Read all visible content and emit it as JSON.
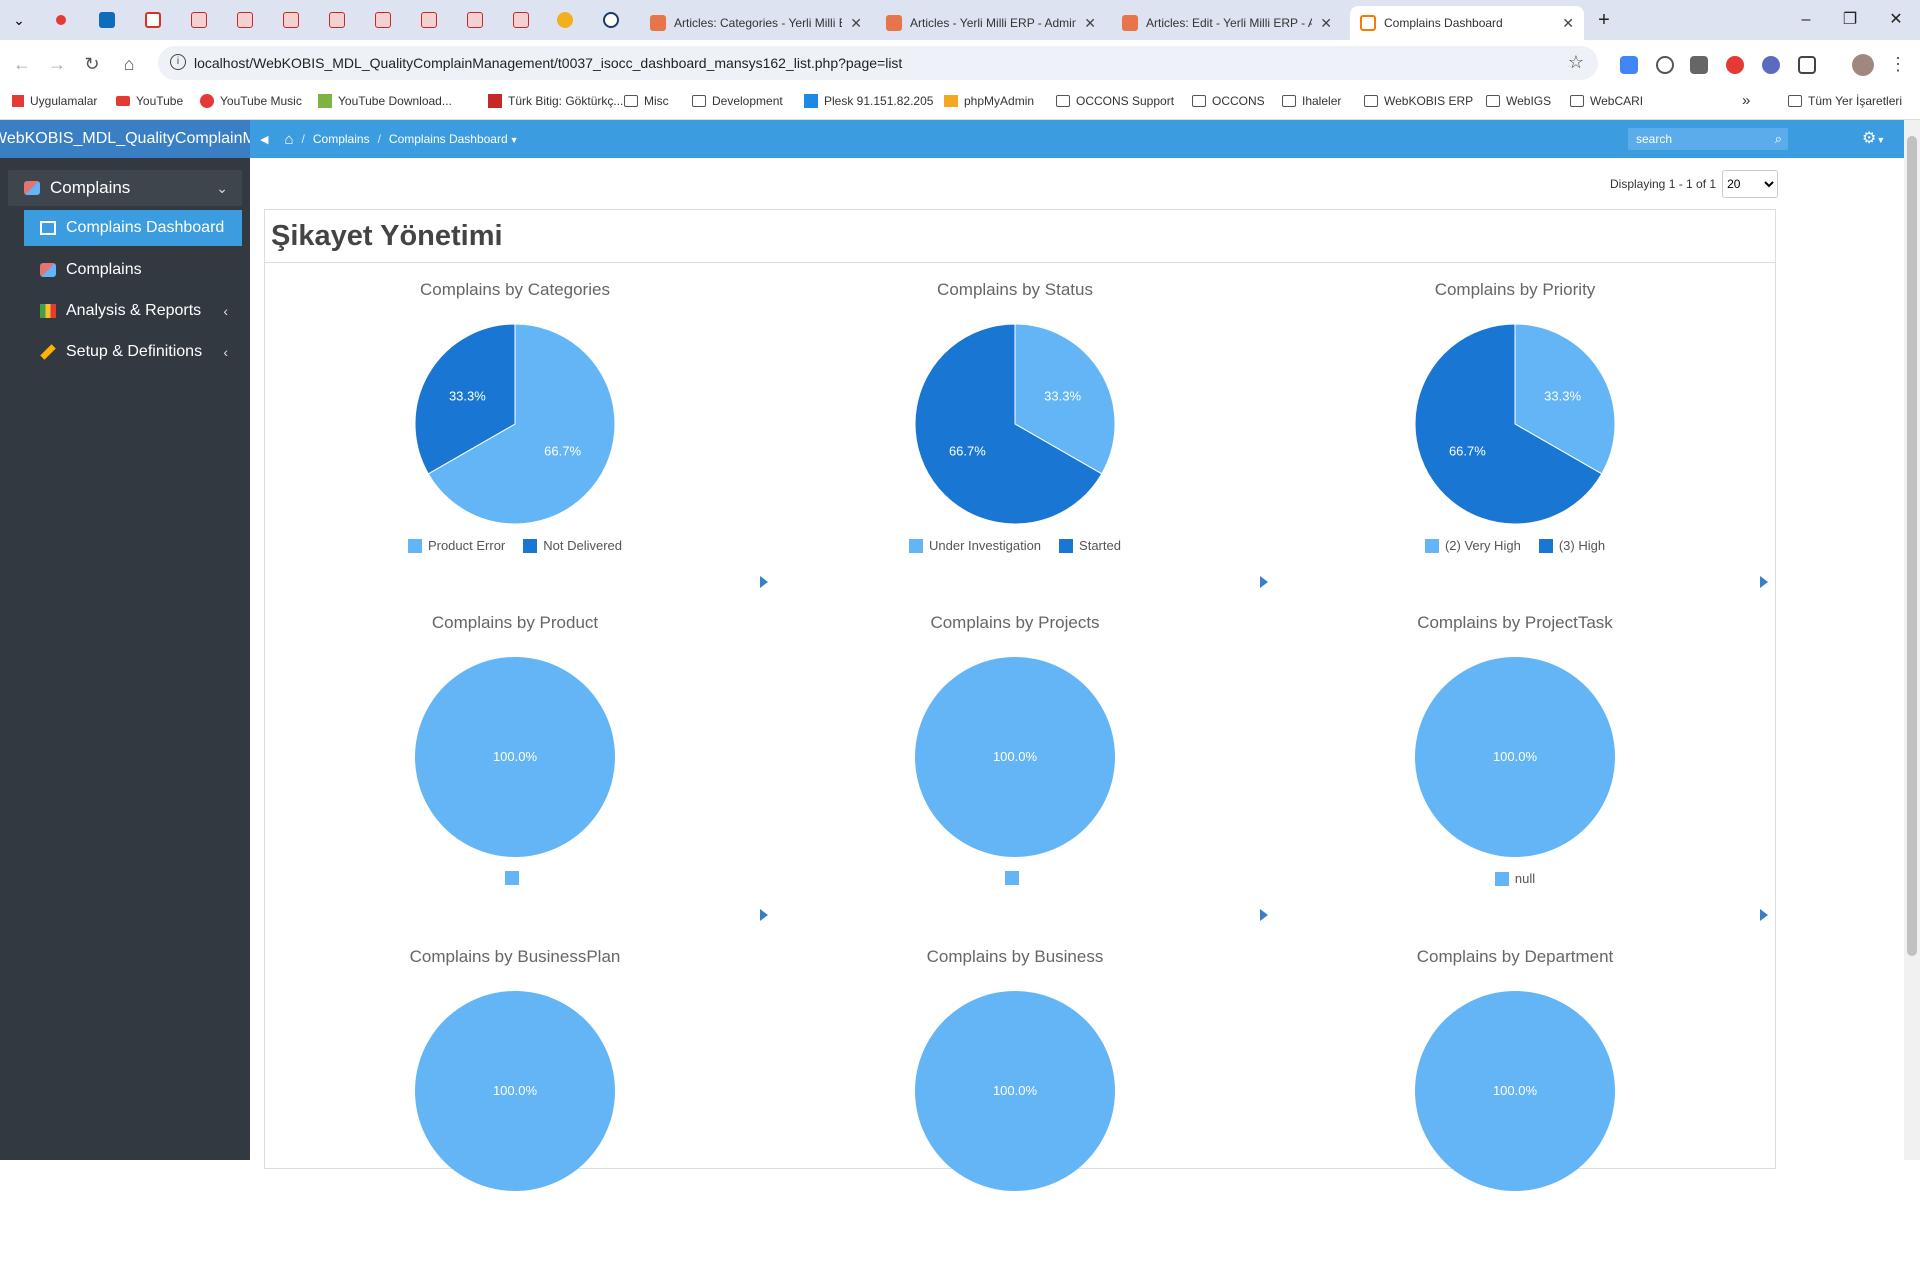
{
  "browser": {
    "tabs": [
      {
        "title": "Articles: Categories - Yerli Milli E"
      },
      {
        "title": "Articles - Yerli Milli ERP - Admin"
      },
      {
        "title": "Articles: Edit - Yerli Milli ERP - A"
      },
      {
        "title": "Complains Dashboard"
      }
    ],
    "url": "localhost/WebKOBIS_MDL_QualityComplainManagement/t0037_isocc_dashboard_mansys162_list.php?page=list",
    "new_tab": "+",
    "bookmarks": [
      "Uygulamalar",
      "YouTube",
      "YouTube Music",
      "YouTube Download...",
      "Türk Bitig: Göktürkç...",
      "Misc",
      "Development",
      "Plesk 91.151.82.205",
      "phpMyAdmin",
      "OCCONS Support",
      "OCCONS",
      "Ihaleler",
      "WebKOBIS ERP",
      "WebIGS",
      "WebCARI"
    ],
    "bookmarks_more": "»",
    "all_bookmarks": "Tüm Yer İşaretleri"
  },
  "header": {
    "brand": "WebKOBIS_MDL_QualityComplainManagement",
    "crumbs": [
      "Complains",
      "Complains Dashboard"
    ],
    "crumb_sep": "/",
    "search_placeholder": "search"
  },
  "sidebar": {
    "items": [
      {
        "label": "Complains"
      },
      {
        "label": "Complains Dashboard"
      },
      {
        "label": "Complains"
      },
      {
        "label": "Analysis & Reports"
      },
      {
        "label": "Setup & Definitions"
      }
    ]
  },
  "paging": {
    "text": "Displaying 1 - 1 of 1",
    "page_size": "20",
    "options": [
      "20"
    ]
  },
  "page_title": "Şikayet Yönetimi",
  "colors": {
    "light": "#64b5f6",
    "dark": "#1976d2",
    "header": "#3c9ce0",
    "sidebar": "#333940"
  },
  "chart_data": [
    {
      "type": "pie",
      "title": "Complains by Categories",
      "labels": [
        "Product Error",
        "Not Delivered"
      ],
      "values": [
        66.7,
        33.3
      ],
      "value_labels": [
        "66.7%",
        "33.3%"
      ]
    },
    {
      "type": "pie",
      "title": "Complains by Status",
      "labels": [
        "Under Investigation",
        "Started"
      ],
      "values": [
        33.3,
        66.7
      ],
      "value_labels": [
        "33.3%",
        "66.7%"
      ]
    },
    {
      "type": "pie",
      "title": "Complains by Priority",
      "labels": [
        "(2) Very High",
        "(3) High"
      ],
      "values": [
        33.3,
        66.7
      ],
      "value_labels": [
        "33.3%",
        "66.7%"
      ]
    },
    {
      "type": "pie",
      "title": "Complains by Product",
      "labels": [
        ""
      ],
      "values": [
        100.0
      ],
      "value_labels": [
        "100.0%"
      ]
    },
    {
      "type": "pie",
      "title": "Complains by Projects",
      "labels": [
        ""
      ],
      "values": [
        100.0
      ],
      "value_labels": [
        "100.0%"
      ]
    },
    {
      "type": "pie",
      "title": "Complains by ProjectTask",
      "labels": [
        "null"
      ],
      "values": [
        100.0
      ],
      "value_labels": [
        "100.0%"
      ]
    },
    {
      "type": "pie",
      "title": "Complains by BusinessPlan",
      "labels": [],
      "values": [
        100.0
      ],
      "value_labels": [
        "100.0%"
      ]
    },
    {
      "type": "pie",
      "title": "Complains by Business",
      "labels": [],
      "values": [
        100.0
      ],
      "value_labels": [
        "100.0%"
      ]
    },
    {
      "type": "pie",
      "title": "Complains by Department",
      "labels": [],
      "values": [
        100.0
      ],
      "value_labels": [
        "100.0%"
      ]
    }
  ]
}
